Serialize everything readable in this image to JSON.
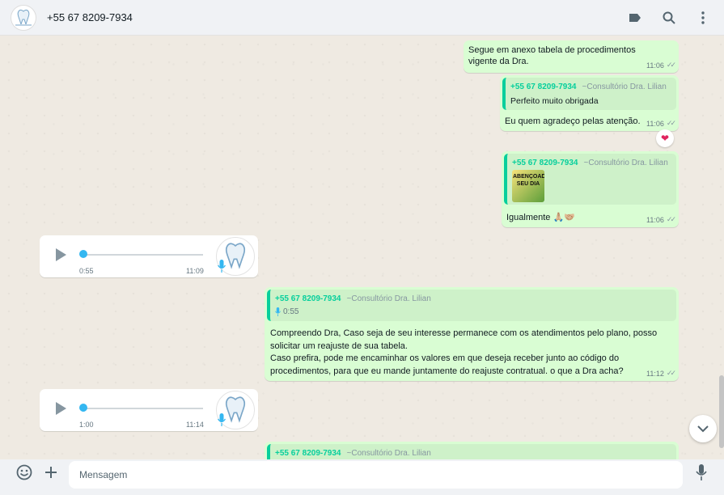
{
  "header": {
    "contact": "+55 67 8209-7934",
    "icons": [
      "label-icon",
      "search-icon",
      "menu-icon"
    ]
  },
  "messages": {
    "m1": {
      "text": "Segue em anexo tabela de procedimentos vigente da Dra.",
      "time": "11:06"
    },
    "m2": {
      "quote_author": "+55 67 8209-7934",
      "quote_tag": "~Consultório Dra. Lilian",
      "quote_text": "Perfeito muito obrigada",
      "text": "Eu quem agradeço pelas atenção.",
      "time": "11:06",
      "reaction": "❤"
    },
    "m3": {
      "quote_author": "+55 67 8209-7934",
      "quote_tag": "~Consultório Dra. Lilian",
      "sticker_text": "ABENÇOADO SEU DIA",
      "text": "Igualmente 🙏🏼🤝🏼",
      "time": "11:06"
    },
    "m4": {
      "duration": "0:55",
      "time": "11:09"
    },
    "m5": {
      "quote_author": "+55 67 8209-7934",
      "quote_tag": "~Consultório Dra. Lilian",
      "quote_audio": "0:55",
      "text": "Compreendo Dra, Caso seja de seu interesse permanece com os atendimentos pelo plano, posso solicitar um reajuste de sua tabela.\nCaso prefira, pode me encaminhar os valores em que deseja receber junto ao código do procedimentos, para que eu mande juntamente do reajuste contratual. o que a Dra acha?",
      "time": "11:12"
    },
    "m6": {
      "duration": "1:00",
      "time": "11:14"
    },
    "m7": {
      "quote_author": "+55 67 8209-7934",
      "quote_tag": "~Consultório Dra. Lilian"
    }
  },
  "composer": {
    "placeholder": "Mensagem",
    "icons": [
      "emoji-icon",
      "plus-icon",
      "mic-icon"
    ]
  },
  "colors": {
    "outgoing_bubble": "#d9fdd3",
    "incoming_bubble": "#ffffff",
    "quote_accent": "#06cf9c",
    "audio_dot": "#34b7f1",
    "chat_background": "#efeae2"
  }
}
